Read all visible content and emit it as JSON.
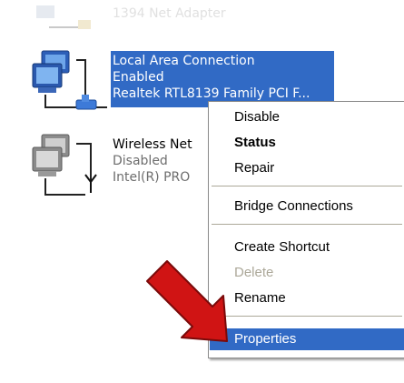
{
  "connections": [
    {
      "name": "1394 Net Adapter"
    },
    {
      "name": "Local Area Connection",
      "status": "Enabled",
      "device": "Realtek RTL8139 Family PCI F..."
    },
    {
      "name": "Wireless Net",
      "status": "Disabled",
      "device": "Intel(R) PRO"
    }
  ],
  "context_menu": {
    "items": [
      {
        "label": "Disable"
      },
      {
        "label": "Status"
      },
      {
        "label": "Repair"
      },
      {
        "label": "Bridge Connections"
      },
      {
        "label": "Create Shortcut"
      },
      {
        "label": "Delete",
        "disabled": true
      },
      {
        "label": "Rename"
      },
      {
        "label": "Properties",
        "highlighted": true
      }
    ]
  },
  "colors": {
    "selection": "#316ac5",
    "disabled_text": "#aca899",
    "arrow": "#d01414"
  },
  "icons": [
    "network-connection-icon",
    "wireless-connection-icon",
    "red-arrow-icon"
  ]
}
